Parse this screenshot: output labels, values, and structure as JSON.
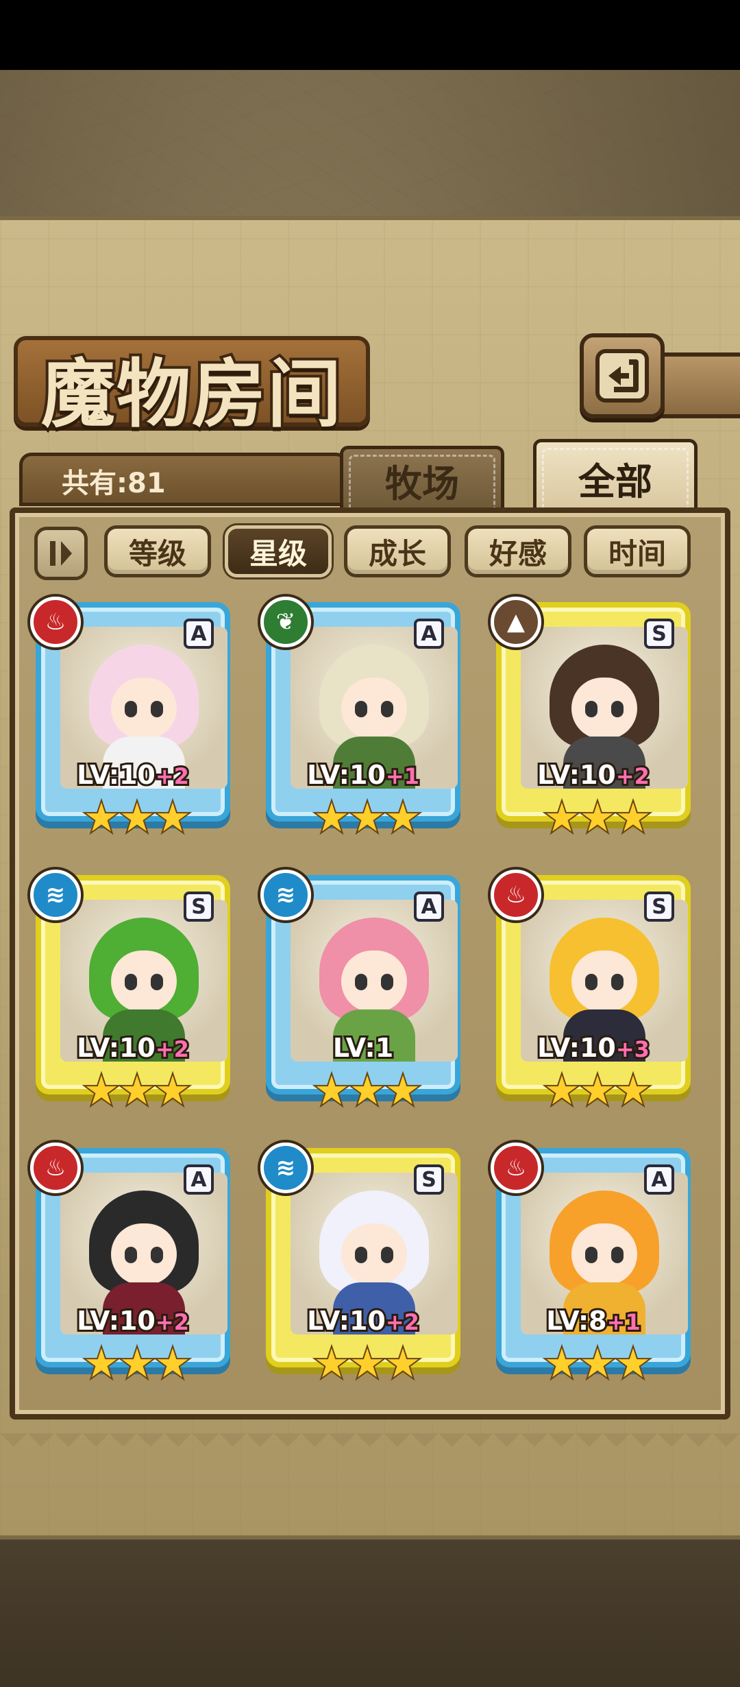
{
  "title": "魔物房间",
  "count_label": "共有:81",
  "tabs": {
    "ranch": "牧场",
    "all": "全部"
  },
  "sort_buttons": [
    {
      "label": "等级",
      "active": false
    },
    {
      "label": "星级",
      "active": true
    },
    {
      "label": "成长",
      "active": false
    },
    {
      "label": "好感",
      "active": false
    },
    {
      "label": "时间",
      "active": false
    }
  ],
  "monsters": [
    {
      "element": "fire-icon",
      "rank": "A",
      "level": "LV:10",
      "bonus": "+2",
      "stars": 3,
      "hair": "#f6d6e6",
      "outfit": "#f2f2f2"
    },
    {
      "element": "leaf-icon",
      "rank": "A",
      "level": "LV:10",
      "bonus": "+1",
      "stars": 3,
      "hair": "#e8e2c6",
      "outfit": "#4f7d38"
    },
    {
      "element": "mountain-icon",
      "rank": "S",
      "level": "LV:10",
      "bonus": "+2",
      "stars": 3,
      "hair": "#4a3426",
      "outfit": "#4a4a4a"
    },
    {
      "element": "water-icon",
      "rank": "S",
      "level": "LV:10",
      "bonus": "+2",
      "stars": 3,
      "hair": "#4fae34",
      "outfit": "#3f7a2e"
    },
    {
      "element": "water-icon",
      "rank": "A",
      "level": "LV:1",
      "bonus": "",
      "stars": 3,
      "hair": "#f08fa8",
      "outfit": "#6aa346"
    },
    {
      "element": "fire-icon",
      "rank": "S",
      "level": "LV:10",
      "bonus": "+3",
      "stars": 3,
      "hair": "#f6c030",
      "outfit": "#2c2c3a"
    },
    {
      "element": "fire-icon",
      "rank": "A",
      "level": "LV:10",
      "bonus": "+2",
      "stars": 3,
      "hair": "#2a2a2a",
      "outfit": "#7a1f2e"
    },
    {
      "element": "water-icon",
      "rank": "S",
      "level": "LV:10",
      "bonus": "+2",
      "stars": 3,
      "hair": "#f1f1fb",
      "outfit": "#3f5fa8"
    },
    {
      "element": "fire-icon",
      "rank": "A",
      "level": "LV:8",
      "bonus": "+1",
      "stars": 3,
      "hair": "#f7a12a",
      "outfit": "#f0b030"
    }
  ]
}
